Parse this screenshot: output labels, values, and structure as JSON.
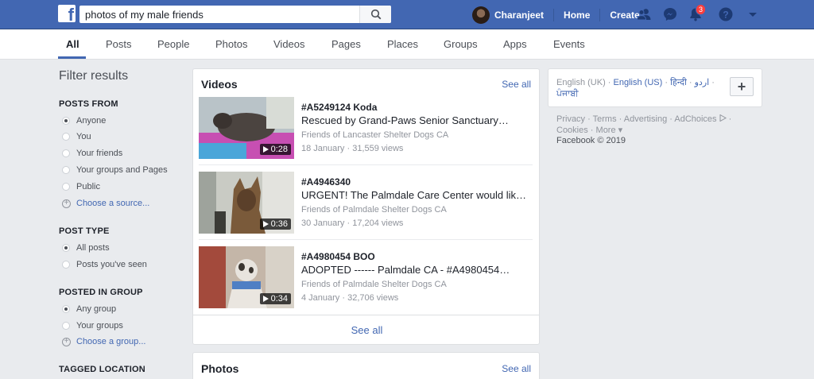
{
  "topbar": {
    "logo": "f",
    "search": {
      "value": "photos of my male friends",
      "placeholder": "Search"
    },
    "user_name": "Charanjeet",
    "home": "Home",
    "create": "Create",
    "notification_count": "3",
    "brand_color": "#4267b2",
    "icons": [
      "search-icon",
      "friend-requests-icon",
      "messenger-icon",
      "notifications-icon",
      "help-icon",
      "dropdown-caret-icon"
    ]
  },
  "tabs": [
    {
      "label": "All",
      "active": true
    },
    {
      "label": "Posts"
    },
    {
      "label": "People"
    },
    {
      "label": "Photos"
    },
    {
      "label": "Videos"
    },
    {
      "label": "Pages"
    },
    {
      "label": "Places"
    },
    {
      "label": "Groups"
    },
    {
      "label": "Apps"
    },
    {
      "label": "Events"
    }
  ],
  "filters": {
    "title": "Filter results",
    "posts_from": {
      "heading": "POSTS FROM",
      "options": [
        "Anyone",
        "You",
        "Your friends",
        "Your groups and Pages",
        "Public"
      ],
      "selected": "Anyone",
      "choose": "Choose a source..."
    },
    "post_type": {
      "heading": "POST TYPE",
      "options": [
        "All posts",
        "Posts you've seen"
      ],
      "selected": "All posts"
    },
    "posted_in_group": {
      "heading": "POSTED IN GROUP",
      "options": [
        "Any group",
        "Your groups"
      ],
      "selected": "Any group",
      "choose": "Choose a group..."
    },
    "tagged_location": {
      "heading": "TAGGED LOCATION"
    }
  },
  "videos": {
    "title": "Videos",
    "see_all": "See all",
    "bottom_see_all": "See all",
    "items": [
      {
        "title": "#A5249124 Koda",
        "desc": "Rescued by Grand-Paws Senior Sanctuary…",
        "source": "Friends of Lancaster Shelter Dogs CA",
        "meta": "18 January · 31,559 views",
        "duration": "0:28"
      },
      {
        "title": "#A4946340",
        "desc": "URGENT! The Palmdale Care Center would like t…",
        "source": "Friends of Palmdale Shelter Dogs CA",
        "meta": "30 January · 17,204 views",
        "duration": "0:36"
      },
      {
        "title": "#A4980454 BOO",
        "desc": "ADOPTED ------ Palmdale CA - #A4980454…",
        "source": "Friends of Palmdale Shelter Dogs CA",
        "meta": "4 January · 32,706 views",
        "duration": "0:34"
      }
    ]
  },
  "photos": {
    "title": "Photos",
    "see_all": "See all"
  },
  "languages": {
    "current": "English (UK)",
    "others": [
      "English (US)",
      "हिन्दी",
      "اردو",
      "ਪੰਜਾਬੀ"
    ],
    "add": "+"
  },
  "footer": {
    "links": [
      "Privacy",
      "Terms",
      "Advertising",
      "AdChoices",
      "Cookies",
      "More"
    ],
    "more_caret": "▾",
    "copyright": "Facebook © 2019"
  }
}
